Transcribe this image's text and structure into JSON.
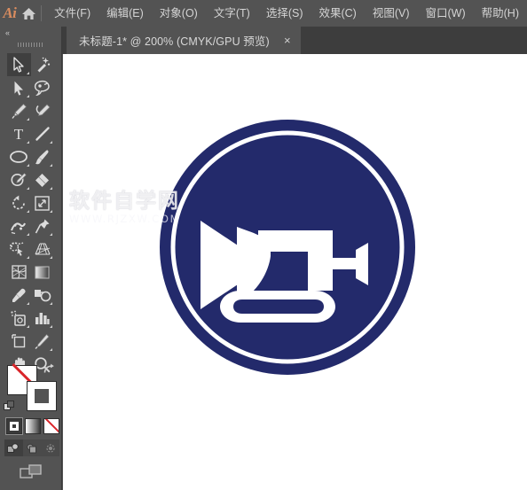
{
  "app": {
    "logo_text": "Ai",
    "home_icon": "home-icon"
  },
  "menubar": {
    "items": [
      {
        "label": "文件(F)",
        "name": "menu-file"
      },
      {
        "label": "编辑(E)",
        "name": "menu-edit"
      },
      {
        "label": "对象(O)",
        "name": "menu-object"
      },
      {
        "label": "文字(T)",
        "name": "menu-type"
      },
      {
        "label": "选择(S)",
        "name": "menu-select"
      },
      {
        "label": "效果(C)",
        "name": "menu-effect"
      },
      {
        "label": "视图(V)",
        "name": "menu-view"
      },
      {
        "label": "窗口(W)",
        "name": "menu-window"
      },
      {
        "label": "帮助(H)",
        "name": "menu-help"
      }
    ]
  },
  "tabs": {
    "active": {
      "title": "未标题-1* @ 200% (CMYK/GPU 预览)",
      "close_label": "×"
    }
  },
  "toolpanel": {
    "collapse_label": "«",
    "tools": [
      {
        "label": "选择工具",
        "icon": "selection-arrow-icon",
        "active": true,
        "corner": true
      },
      {
        "label": "魔棒工具",
        "icon": "magic-wand-icon",
        "active": false,
        "corner": false
      },
      {
        "label": "直接选择工具",
        "icon": "direct-selection-arrow-icon",
        "active": false,
        "corner": true
      },
      {
        "label": "套索工具",
        "icon": "lasso-icon",
        "active": false,
        "corner": false
      },
      {
        "label": "钢笔工具",
        "icon": "pen-icon",
        "active": false,
        "corner": true
      },
      {
        "label": "曲率工具",
        "icon": "curvature-pen-icon",
        "active": false,
        "corner": false
      },
      {
        "label": "文字工具",
        "icon": "type-tool-icon",
        "active": false,
        "corner": true
      },
      {
        "label": "直线段工具",
        "icon": "line-segment-icon",
        "active": false,
        "corner": true
      },
      {
        "label": "椭圆工具",
        "icon": "ellipse-icon",
        "active": false,
        "corner": true
      },
      {
        "label": "画笔工具",
        "icon": "paintbrush-icon",
        "active": false,
        "corner": true
      },
      {
        "label": "铅笔工具",
        "icon": "pencil-shaper-icon",
        "active": false,
        "corner": true
      },
      {
        "label": "橡皮擦工具",
        "icon": "eraser-icon",
        "active": false,
        "corner": true
      },
      {
        "label": "旋转工具",
        "icon": "rotate-icon",
        "active": false,
        "corner": true
      },
      {
        "label": "比例缩放工具",
        "icon": "scale-icon",
        "active": false,
        "corner": true
      },
      {
        "label": "宽度工具",
        "icon": "width-warp-icon",
        "active": false,
        "corner": true
      },
      {
        "label": "自由变换工具",
        "icon": "free-transform-pin-icon",
        "active": false,
        "corner": true
      },
      {
        "label": "形状生成器工具",
        "icon": "shape-builder-icon",
        "active": false,
        "corner": true
      },
      {
        "label": "透视网格工具",
        "icon": "perspective-grid-icon",
        "active": false,
        "corner": true
      },
      {
        "label": "网格工具",
        "icon": "mesh-icon",
        "active": false,
        "corner": false
      },
      {
        "label": "渐变工具",
        "icon": "gradient-icon",
        "active": false,
        "corner": false
      },
      {
        "label": "吸管工具",
        "icon": "eyedropper-icon",
        "active": false,
        "corner": true
      },
      {
        "label": "混合工具",
        "icon": "blend-icon",
        "active": false,
        "corner": true
      },
      {
        "label": "符号喷枪工具",
        "icon": "symbol-sprayer-icon",
        "active": false,
        "corner": true
      },
      {
        "label": "柱形图工具",
        "icon": "column-graph-icon",
        "active": false,
        "corner": true
      },
      {
        "label": "画板工具",
        "icon": "artboard-icon",
        "active": false,
        "corner": false
      },
      {
        "label": "切片工具",
        "icon": "slice-knife-icon",
        "active": false,
        "corner": true
      },
      {
        "label": "抓手工具",
        "icon": "hand-icon",
        "active": false,
        "corner": true
      },
      {
        "label": "缩放工具",
        "icon": "zoom-magnifier-icon",
        "active": false,
        "corner": false
      }
    ],
    "color": {
      "fill_label": "填色",
      "fill_color": "#ffffff",
      "fill_is_none": true,
      "none_slash_color": "#d9252a",
      "stroke_label": "描边",
      "stroke_color": "#ffffff",
      "swap_label": "互换填色和描边",
      "default_label": "默认填色和描边",
      "modes": [
        {
          "label": "颜色",
          "name": "color-mode-button",
          "selected": true
        },
        {
          "label": "渐变",
          "name": "gradient-mode-button",
          "selected": false
        },
        {
          "label": "无",
          "name": "none-mode-button",
          "selected": false
        }
      ],
      "draw_modes": [
        {
          "label": "正常绘图",
          "name": "draw-normal-button",
          "selected": true
        },
        {
          "label": "背面绘图",
          "name": "draw-behind-button",
          "selected": false
        },
        {
          "label": "内部绘图",
          "name": "draw-inside-button",
          "selected": false
        }
      ],
      "screen_mode_label": "更改屏幕模式"
    }
  },
  "canvas": {
    "artwork": {
      "name": "bugle-horn-badge-artwork",
      "navy": "#232a6b",
      "white": "#ffffff",
      "description": "圆形徽章中的号角图形"
    },
    "watermark": {
      "line1": "软件自学网",
      "line2": "WWW.RJZXW.COM"
    }
  },
  "colors": {
    "chrome": "#535353",
    "tabbar": "#3d3d3d",
    "canvas_bg": "#ffffff",
    "accent_orange": "#d98c5f",
    "artwork_navy": "#232a6b"
  }
}
